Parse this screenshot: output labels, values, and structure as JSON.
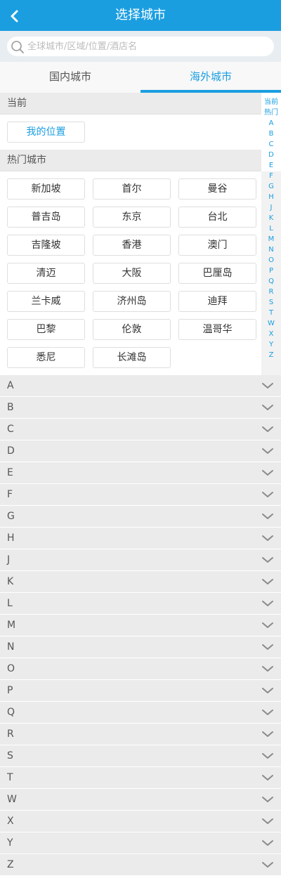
{
  "header": {
    "title": "选择城市"
  },
  "search": {
    "placeholder": "全球城市/区域/位置/酒店名"
  },
  "tabs": [
    {
      "label": "国内城市",
      "active": false
    },
    {
      "label": "海外城市",
      "active": true
    }
  ],
  "current": {
    "heading": "当前",
    "location_label": "我的位置"
  },
  "hot": {
    "heading": "热门城市",
    "cities": [
      "新加坡",
      "首尔",
      "曼谷",
      "普吉岛",
      "东京",
      "台北",
      "吉隆坡",
      "香港",
      "澳门",
      "清迈",
      "大阪",
      "巴厘岛",
      "兰卡威",
      "济州岛",
      "迪拜",
      "巴黎",
      "伦敦",
      "温哥华",
      "悉尼",
      "长滩岛"
    ]
  },
  "index_bar": [
    "当前",
    "热门",
    "A",
    "B",
    "C",
    "D",
    "E",
    "F",
    "G",
    "H",
    "J",
    "K",
    "L",
    "M",
    "N",
    "O",
    "P",
    "Q",
    "R",
    "S",
    "T",
    "W",
    "X",
    "Y",
    "Z"
  ],
  "letters": [
    "A",
    "B",
    "C",
    "D",
    "E",
    "F",
    "G",
    "H",
    "J",
    "K",
    "L",
    "M",
    "N",
    "O",
    "P",
    "Q",
    "R",
    "S",
    "T",
    "W",
    "X",
    "Y",
    "Z"
  ],
  "colors": {
    "accent": "#1a9ee0",
    "section_bg": "#ebebeb"
  },
  "icons": {
    "back": "chevron-left-icon",
    "search": "search-icon",
    "expand": "chevron-down-icon"
  }
}
